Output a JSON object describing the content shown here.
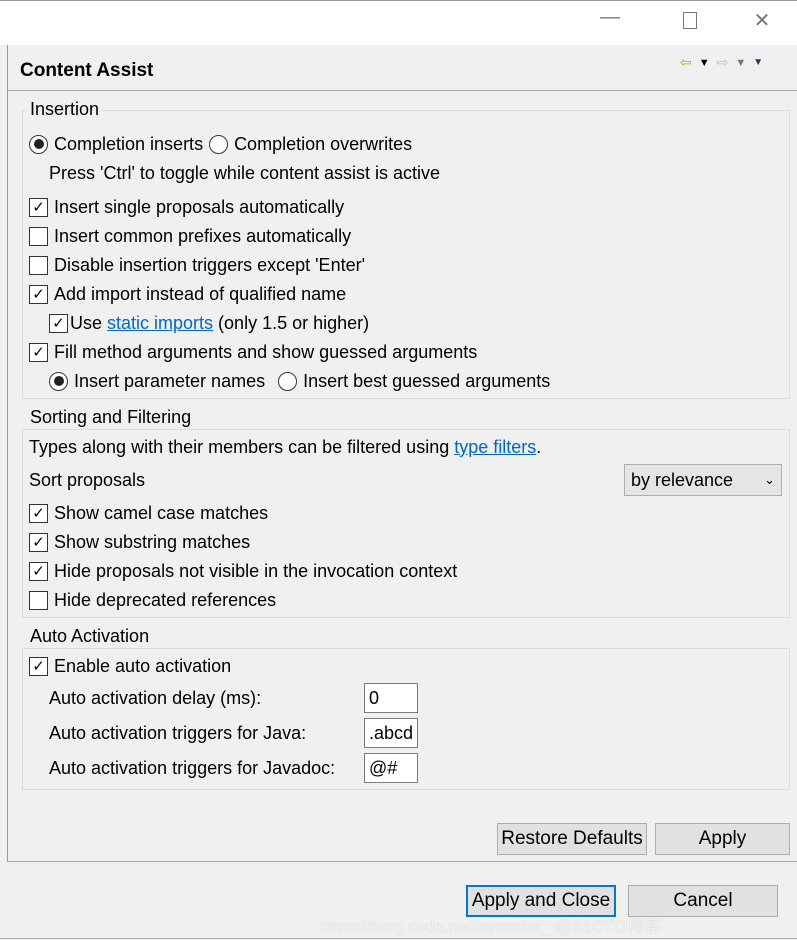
{
  "window": {
    "minimize_icon": "minimize-icon",
    "maximize_icon": "maximize-icon",
    "close_icon": "close-icon"
  },
  "header": {
    "title": "Content Assist",
    "nav_icons": [
      "back-arrow-icon",
      "back-dropdown-icon",
      "forward-arrow-icon",
      "forward-dropdown-icon",
      "menu-dropdown-icon"
    ],
    "back_color": "#d89a00"
  },
  "insertion": {
    "title": "Insertion",
    "completion_inserts": "Completion inserts",
    "completion_overwrites": "Completion overwrites",
    "completion_selected": "inserts",
    "hint": "Press 'Ctrl' to toggle while content assist is active",
    "insert_single": {
      "label": "Insert single proposals automatically",
      "checked": true
    },
    "insert_common": {
      "label": "Insert common prefixes automatically",
      "checked": false
    },
    "disable_triggers": {
      "label": "Disable insertion triggers except 'Enter'",
      "checked": false
    },
    "add_import": {
      "label": "Add import instead of qualified name",
      "checked": true
    },
    "use_static": {
      "label_pre": "Use ",
      "link": "static imports",
      "label_post": " (only 1.5 or higher)",
      "checked": true
    },
    "fill_args": {
      "label": "Fill method arguments and show guessed arguments",
      "checked": true
    },
    "param_names": "Insert parameter names",
    "best_guessed": "Insert best guessed arguments",
    "args_selected": "param_names"
  },
  "sorting": {
    "title": "Sorting and Filtering",
    "desc_pre": "Types along with their members can be filtered using ",
    "desc_link": "type filters",
    "desc_post": ".",
    "sort_label": "Sort proposals",
    "sort_value": "by relevance",
    "camel": {
      "label": "Show camel case matches",
      "checked": true
    },
    "substring": {
      "label": "Show substring matches",
      "checked": true
    },
    "hide_invisible": {
      "label": "Hide proposals not visible in the invocation context",
      "checked": true
    },
    "hide_deprecated": {
      "label": "Hide deprecated references",
      "checked": false
    }
  },
  "auto": {
    "title": "Auto Activation",
    "enable": {
      "label": "Enable auto activation",
      "checked": true
    },
    "delay_label": "Auto activation delay (ms):",
    "delay_value": "0",
    "java_label": "Auto activation triggers for Java:",
    "java_value": ".abcd",
    "javadoc_label": "Auto activation triggers for Javadoc:",
    "javadoc_value": "@#"
  },
  "buttons": {
    "restore": "Restore Defaults",
    "apply": "Apply",
    "apply_close": "Apply and Close",
    "cancel": "Cancel",
    "focus_color": "#0078d7"
  },
  "watermark": "https://blog.csdn.net/lannister_ @51CTO博客"
}
